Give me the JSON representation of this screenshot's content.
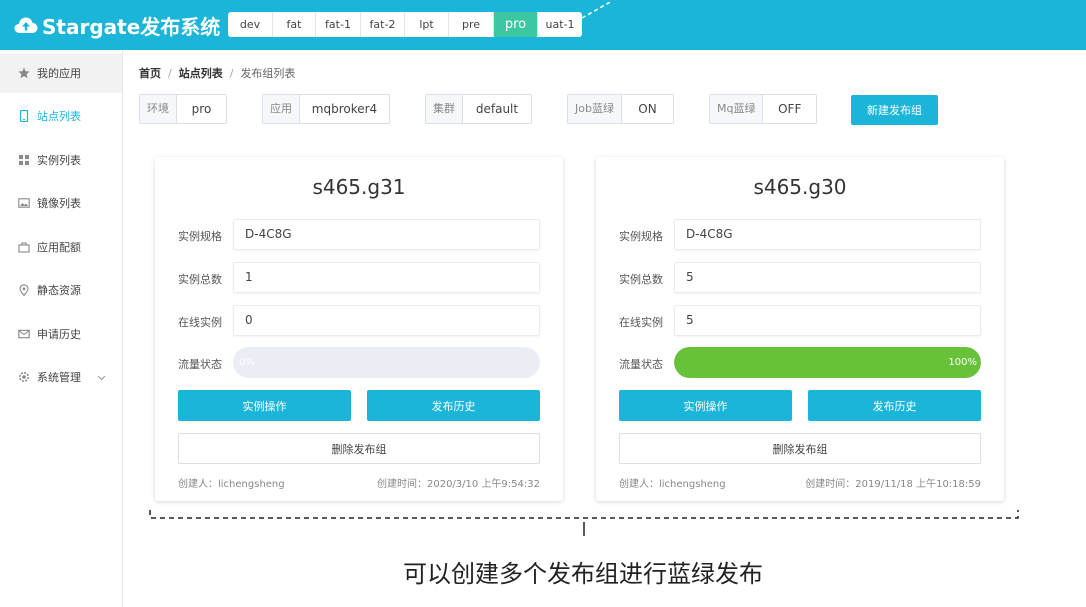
{
  "app": {
    "title": "Stargate发布系统"
  },
  "env_tabs": [
    {
      "label": "dev",
      "active": false
    },
    {
      "label": "fat",
      "active": false
    },
    {
      "label": "fat-1",
      "active": false
    },
    {
      "label": "fat-2",
      "active": false
    },
    {
      "label": "lpt",
      "active": false
    },
    {
      "label": "pre",
      "active": false
    },
    {
      "label": "pro",
      "active": true
    },
    {
      "label": "uat-1",
      "active": false
    }
  ],
  "sidebar": {
    "items": [
      {
        "label": "我的应用",
        "icon": "star-icon"
      },
      {
        "label": "站点列表",
        "icon": "tablet-icon",
        "active": true
      },
      {
        "label": "实例列表",
        "icon": "grid-icon"
      },
      {
        "label": "镜像列表",
        "icon": "image-icon"
      },
      {
        "label": "应用配额",
        "icon": "bag-icon"
      },
      {
        "label": "静态资源",
        "icon": "location-icon"
      },
      {
        "label": "申请历史",
        "icon": "mail-icon"
      },
      {
        "label": "系统管理",
        "icon": "gear-icon"
      }
    ]
  },
  "breadcrumb": {
    "home": "首页",
    "sep": "/",
    "sites": "站点列表",
    "current": "发布组列表"
  },
  "filters": {
    "env": {
      "label": "环境",
      "value": "pro"
    },
    "app": {
      "label": "应用",
      "value": "mqbroker4"
    },
    "cluster": {
      "label": "集群",
      "value": "default"
    },
    "job_bg": {
      "label": "Job蓝绿",
      "value": "ON"
    },
    "mq_bg": {
      "label": "Mq蓝绿",
      "value": "OFF"
    }
  },
  "new_group_button": "新建发布组",
  "cards": [
    {
      "title": "s465.g31",
      "spec_label": "实例规格",
      "spec": "D-4C8G",
      "total_label": "实例总数",
      "total": "1",
      "online_label": "在线实例",
      "online": "0",
      "traffic_label": "流量状态",
      "traffic_percent": 0,
      "traffic_text": "0%",
      "ops_button": "实例操作",
      "history_button": "发布历史",
      "delete_button": "删除发布组",
      "creator": "创建人：lichengsheng",
      "created_time": "创建时间：2020/3/10 上午9:54:32"
    },
    {
      "title": "s465.g30",
      "spec_label": "实例规格",
      "spec": "D-4C8G",
      "total_label": "实例总数",
      "total": "5",
      "online_label": "在线实例",
      "online": "5",
      "traffic_label": "流量状态",
      "traffic_percent": 100,
      "traffic_text": "100%",
      "ops_button": "实例操作",
      "history_button": "发布历史",
      "delete_button": "删除发布组",
      "creator": "创建人：lichengsheng",
      "created_time": "创建时间：2019/11/18 上午10:18:59"
    }
  ],
  "annotation": "可以创建多个发布组进行蓝绿发布",
  "colors": {
    "header": "#1ab5d8",
    "active_tab": "#3cc7a2",
    "progress_fill": "#67c23a",
    "button": "#1ab5d8"
  }
}
